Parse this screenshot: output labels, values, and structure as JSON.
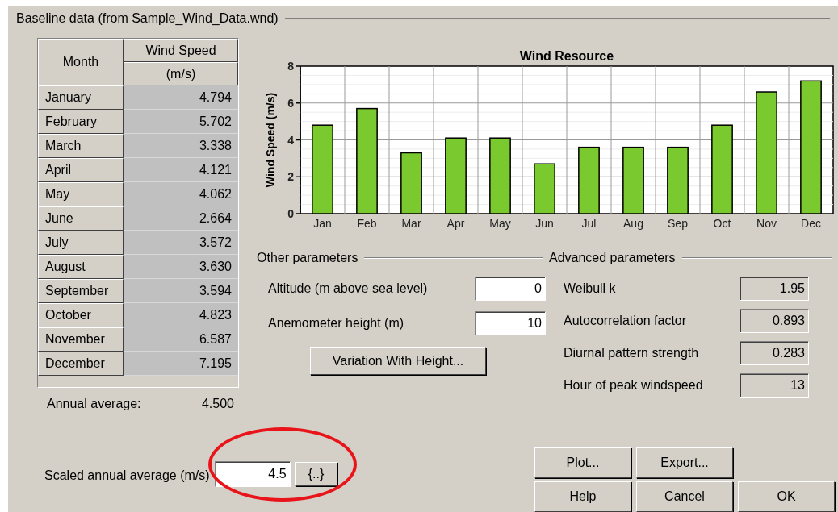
{
  "group_title": "Baseline data (from Sample_Wind_Data.wnd)",
  "table": {
    "month_header": "Month",
    "value_header": "Wind Speed",
    "unit_header": "(m/s)",
    "rows": [
      {
        "month": "January",
        "value": "4.794"
      },
      {
        "month": "February",
        "value": "5.702"
      },
      {
        "month": "March",
        "value": "3.338"
      },
      {
        "month": "April",
        "value": "4.121"
      },
      {
        "month": "May",
        "value": "4.062"
      },
      {
        "month": "June",
        "value": "2.664"
      },
      {
        "month": "July",
        "value": "3.572"
      },
      {
        "month": "August",
        "value": "3.630"
      },
      {
        "month": "September",
        "value": "3.594"
      },
      {
        "month": "October",
        "value": "4.823"
      },
      {
        "month": "November",
        "value": "6.587"
      },
      {
        "month": "December",
        "value": "7.195"
      }
    ]
  },
  "annual_average": {
    "label": "Annual average:",
    "value": "4.500"
  },
  "chart": {
    "chart_data": {
      "type": "bar",
      "title": "Wind Resource",
      "ylabel": "Wind Speed (m/s)",
      "categories": [
        "Jan",
        "Feb",
        "Mar",
        "Apr",
        "May",
        "Jun",
        "Jul",
        "Aug",
        "Sep",
        "Oct",
        "Nov",
        "Dec"
      ],
      "series": [
        {
          "color": "#7ac92e",
          "values": [
            4.8,
            5.7,
            3.3,
            4.1,
            4.1,
            2.7,
            3.6,
            3.6,
            3.6,
            4.8,
            6.6,
            7.2
          ]
        }
      ],
      "ylim": [
        0,
        8
      ],
      "yticks": [
        0,
        2,
        4,
        6,
        8
      ],
      "grid": true
    }
  },
  "other_parameters": {
    "title": "Other parameters",
    "fields": [
      {
        "label": "Altitude (m above sea level)",
        "value": "0"
      },
      {
        "label": "Anemometer height (m)",
        "value": "10"
      }
    ],
    "button": "Variation With Height..."
  },
  "advanced_parameters": {
    "title": "Advanced parameters",
    "fields": [
      {
        "label": "Weibull k",
        "value": "1.95"
      },
      {
        "label": "Autocorrelation factor",
        "value": "0.893"
      },
      {
        "label": "Diurnal pattern strength",
        "value": "0.283"
      },
      {
        "label": "Hour of peak windspeed",
        "value": "13"
      }
    ]
  },
  "scaled_average": {
    "label": "Scaled annual average (m/s)",
    "value": "4.5",
    "button": "{..}",
    "highlighted": true
  },
  "button_rows": [
    [
      "Plot...",
      "Export..."
    ],
    [
      "Help",
      "Cancel",
      "OK"
    ]
  ]
}
